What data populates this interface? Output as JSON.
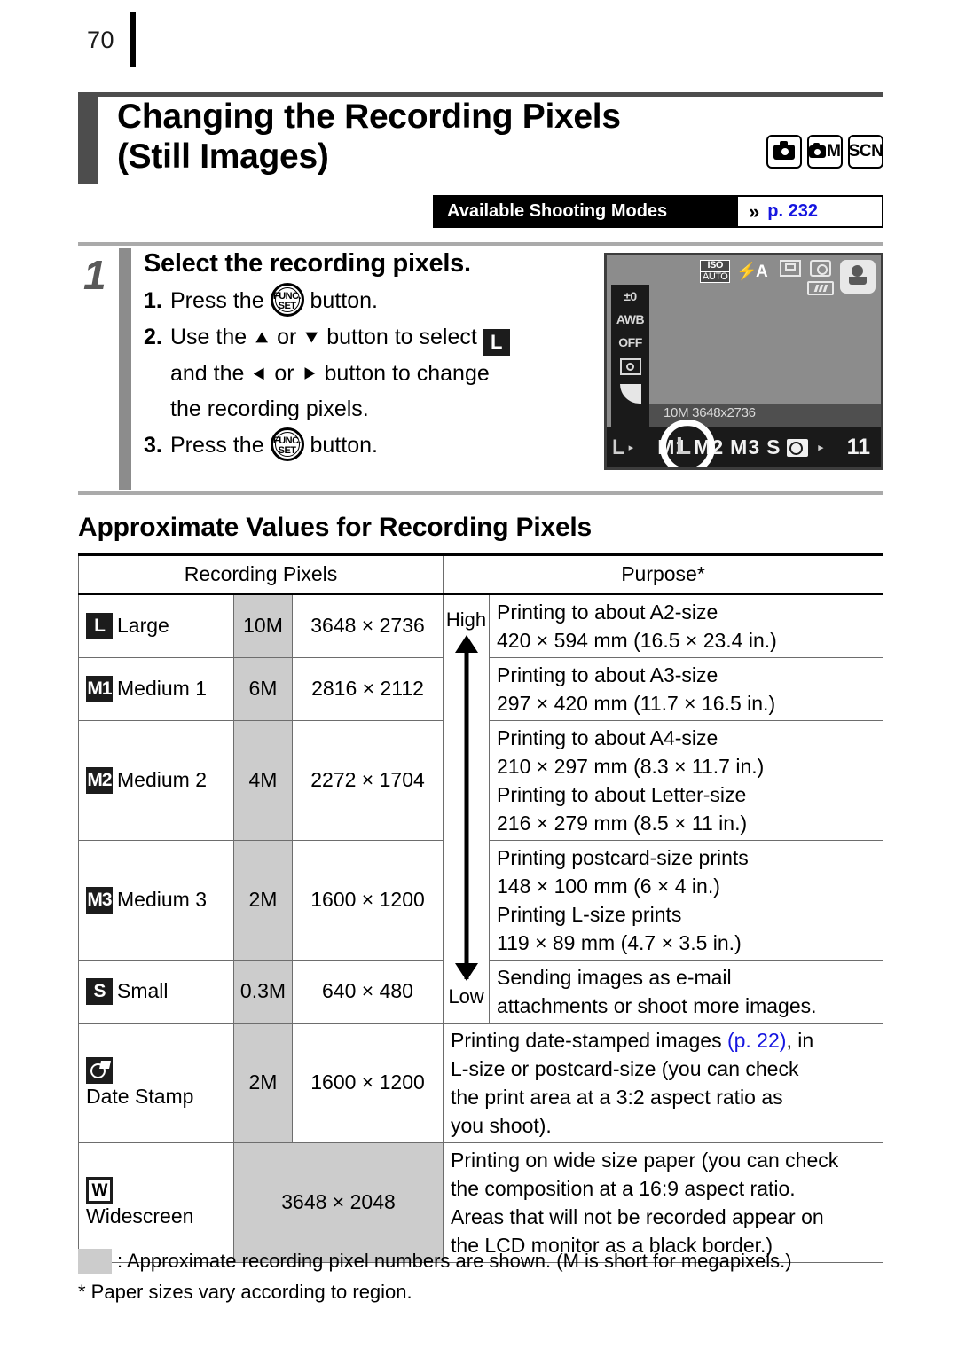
{
  "page": {
    "number": "70"
  },
  "title": {
    "line1": "Changing the Recording Pixels",
    "line2": "(Still Images)",
    "mode_icons": [
      "camera-auto-icon",
      "camera-manual-icon",
      "scn-icon"
    ],
    "mode_m_label": "M",
    "mode_scn_label": "SCN"
  },
  "available_modes": {
    "label": "Available Shooting Modes",
    "chevron": "»",
    "page_ref": "p. 232",
    "link_color": "#1515e0"
  },
  "step": {
    "number": "1",
    "title": "Select the recording pixels.",
    "items": [
      {
        "n": "1.",
        "pre": "Press the",
        "post": "button."
      },
      {
        "n": "2.",
        "pre": "Use the",
        "post": "button to change"
      },
      {
        "n": "3.",
        "pre": "Press the",
        "post": "button."
      }
    ],
    "item2_text_a": "Use the",
    "item2_or": "or",
    "item2_text_b": "button to select",
    "item2_text_c": "and the",
    "item2_text_d": "button to change",
    "item2_text_e": "the recording pixels.",
    "funcset_line1": "FUNC.",
    "funcset_line2": "SET",
    "arrow_up": "↑",
    "arrow_down": "↓",
    "arrow_left": "←",
    "arrow_right": "→",
    "badge_large": "L"
  },
  "lcd": {
    "exposure": "±0",
    "white_balance": "AWB",
    "my_colors": "OFF",
    "metering": "evaluative-metering-icon",
    "compression": "compression-fine-icon",
    "iso_top": "ISO",
    "iso_bottom": "AUTO",
    "flash": "⚡A",
    "drive_icon": "single-shot-icon",
    "camera_icon": "camera-icon",
    "battery_icon": "battery-icon",
    "mode_icon": "shooting-mode-icon",
    "info_text": "10M  3648x2736",
    "selector_current": "L",
    "selector_triangle_left": "▸",
    "selector_items": [
      "L",
      "M1",
      "M2",
      "M3",
      "S"
    ],
    "selector_date_icon": "date-stamp-icon",
    "selector_triangle_right": "▸",
    "shots_remaining": "11",
    "highlighted": "L"
  },
  "section2": {
    "heading": "Approximate Values for Recording Pixels"
  },
  "table": {
    "headers": {
      "left": "Recording Pixels",
      "right": "Purpose*"
    },
    "quality_high": "High",
    "quality_low": "Low",
    "rows": [
      {
        "icon": "L",
        "icon_type": "dark",
        "name": "Large",
        "mp": "10M",
        "dim": "3648 × 2736",
        "purpose": [
          "Printing to about A2-size",
          "420 × 594 mm (16.5 × 23.4 in.)"
        ]
      },
      {
        "icon": "M1",
        "icon_type": "dark",
        "name": "Medium 1",
        "mp": "6M",
        "dim": "2816 × 2112",
        "purpose": [
          "Printing to about A3-size",
          "297 × 420 mm (11.7 × 16.5 in.)"
        ]
      },
      {
        "icon": "M2",
        "icon_type": "dark",
        "name": "Medium 2",
        "mp": "4M",
        "dim": "2272 × 1704",
        "purpose": [
          "Printing to about A4-size",
          "210 × 297 mm (8.3 × 11.7 in.)",
          "Printing to about Letter-size",
          "216 × 279 mm (8.5 × 11 in.)"
        ]
      },
      {
        "icon": "M3",
        "icon_type": "dark",
        "name": "Medium 3",
        "mp": "2M",
        "dim": "1600 × 1200",
        "purpose": [
          "Printing postcard-size prints",
          "148 × 100 mm (6 × 4 in.)",
          "Printing L-size prints",
          "119 × 89 mm (4.7 × 3.5 in.)"
        ]
      },
      {
        "icon": "S",
        "icon_type": "dark",
        "name": "Small",
        "mp": "0.3M",
        "dim": "640 × 480",
        "purpose": [
          "Sending images as e-mail",
          "attachments or shoot more images."
        ]
      }
    ],
    "date_stamp_row": {
      "icon": "date-stamp-icon",
      "name": "Date Stamp",
      "mp": "2M",
      "dim": "1600 × 1200",
      "purpose_pre": "Printing date-stamped images ",
      "purpose_link": "(p. 22)",
      "purpose_post": ", in",
      "purpose_rest": [
        "L-size or postcard-size (you can check",
        "the print area at a 3:2 aspect ratio as",
        "you shoot)."
      ]
    },
    "widescreen_row": {
      "icon": "W",
      "name": "Widescreen",
      "mp": "",
      "dim": "3648 × 2048",
      "purpose": [
        "Printing on wide size paper (you can check",
        "the composition at a 16:9 aspect ratio.",
        "Areas that will not be recorded appear on",
        "the LCD monitor as a black border.)"
      ]
    }
  },
  "footnotes": {
    "legend": ": Approximate recording pixel numbers are shown. (M is short for megapixels.)",
    "note": "*  Paper sizes vary according to region."
  }
}
